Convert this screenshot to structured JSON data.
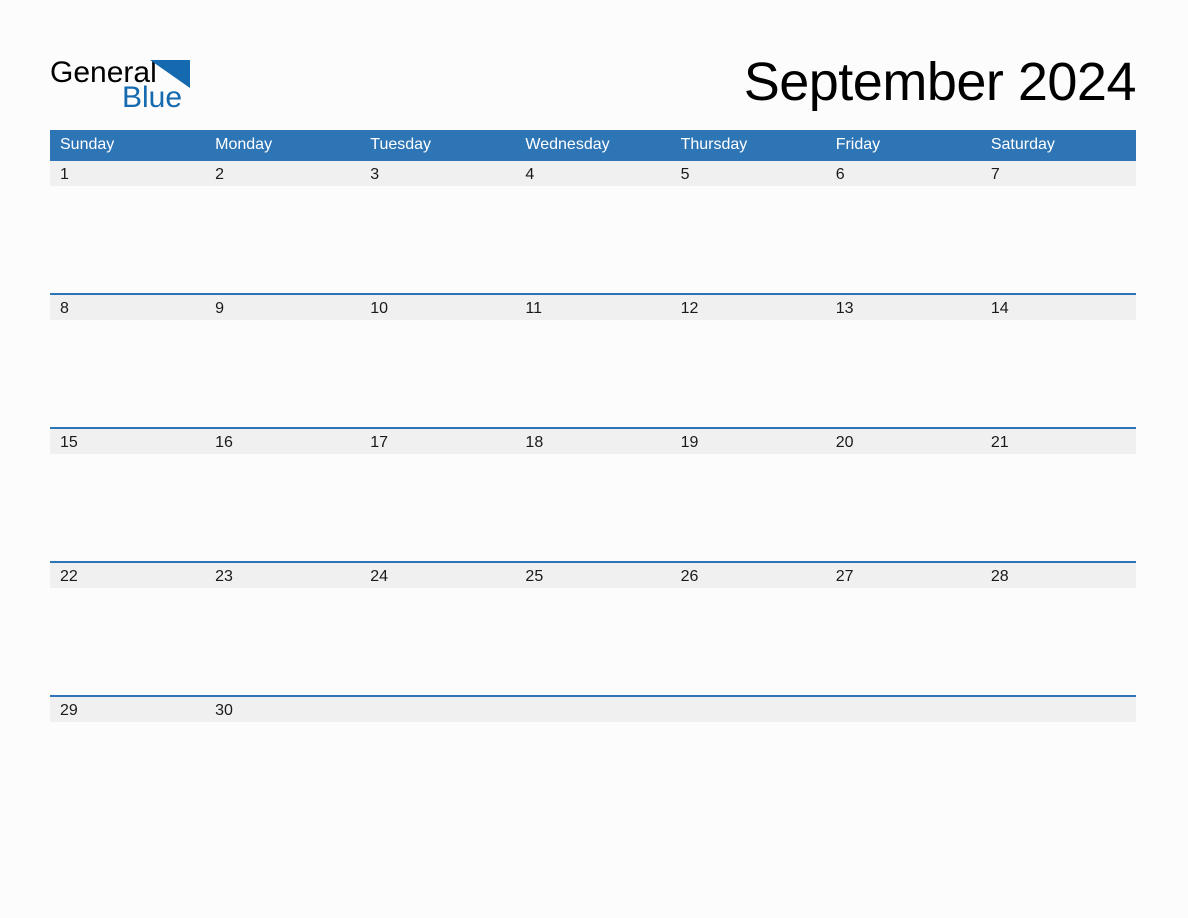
{
  "brand": {
    "name_part_one": "General",
    "name_part_two": "Blue",
    "logo_icon": "triangle-logo-icon",
    "primary_color": "#2E75B6",
    "text_color": "#000000"
  },
  "header": {
    "title": "September 2024",
    "month": "September",
    "year": "2024"
  },
  "colors": {
    "header_band": "#2E75B6",
    "date_strip": "#F0F0F0",
    "page_background": "#FCFCFC",
    "rule": "#2E75B6",
    "day_number_text": "#1A1A1A",
    "weekday_text": "#FFFFFF"
  },
  "calendar": {
    "weekdays": [
      "Sunday",
      "Monday",
      "Tuesday",
      "Wednesday",
      "Thursday",
      "Friday",
      "Saturday"
    ],
    "weeks": [
      {
        "days": [
          {
            "number": "1",
            "blank": false
          },
          {
            "number": "2",
            "blank": false
          },
          {
            "number": "3",
            "blank": false
          },
          {
            "number": "4",
            "blank": false
          },
          {
            "number": "5",
            "blank": false
          },
          {
            "number": "6",
            "blank": false
          },
          {
            "number": "7",
            "blank": false
          }
        ]
      },
      {
        "days": [
          {
            "number": "8",
            "blank": false
          },
          {
            "number": "9",
            "blank": false
          },
          {
            "number": "10",
            "blank": false
          },
          {
            "number": "11",
            "blank": false
          },
          {
            "number": "12",
            "blank": false
          },
          {
            "number": "13",
            "blank": false
          },
          {
            "number": "14",
            "blank": false
          }
        ]
      },
      {
        "days": [
          {
            "number": "15",
            "blank": false
          },
          {
            "number": "16",
            "blank": false
          },
          {
            "number": "17",
            "blank": false
          },
          {
            "number": "18",
            "blank": false
          },
          {
            "number": "19",
            "blank": false
          },
          {
            "number": "20",
            "blank": false
          },
          {
            "number": "21",
            "blank": false
          }
        ]
      },
      {
        "days": [
          {
            "number": "22",
            "blank": false
          },
          {
            "number": "23",
            "blank": false
          },
          {
            "number": "24",
            "blank": false
          },
          {
            "number": "25",
            "blank": false
          },
          {
            "number": "26",
            "blank": false
          },
          {
            "number": "27",
            "blank": false
          },
          {
            "number": "28",
            "blank": false
          }
        ]
      },
      {
        "days": [
          {
            "number": "29",
            "blank": false
          },
          {
            "number": "30",
            "blank": false
          },
          {
            "number": "",
            "blank": true
          },
          {
            "number": "",
            "blank": true
          },
          {
            "number": "",
            "blank": true
          },
          {
            "number": "",
            "blank": true
          },
          {
            "number": "",
            "blank": true
          }
        ]
      }
    ]
  }
}
